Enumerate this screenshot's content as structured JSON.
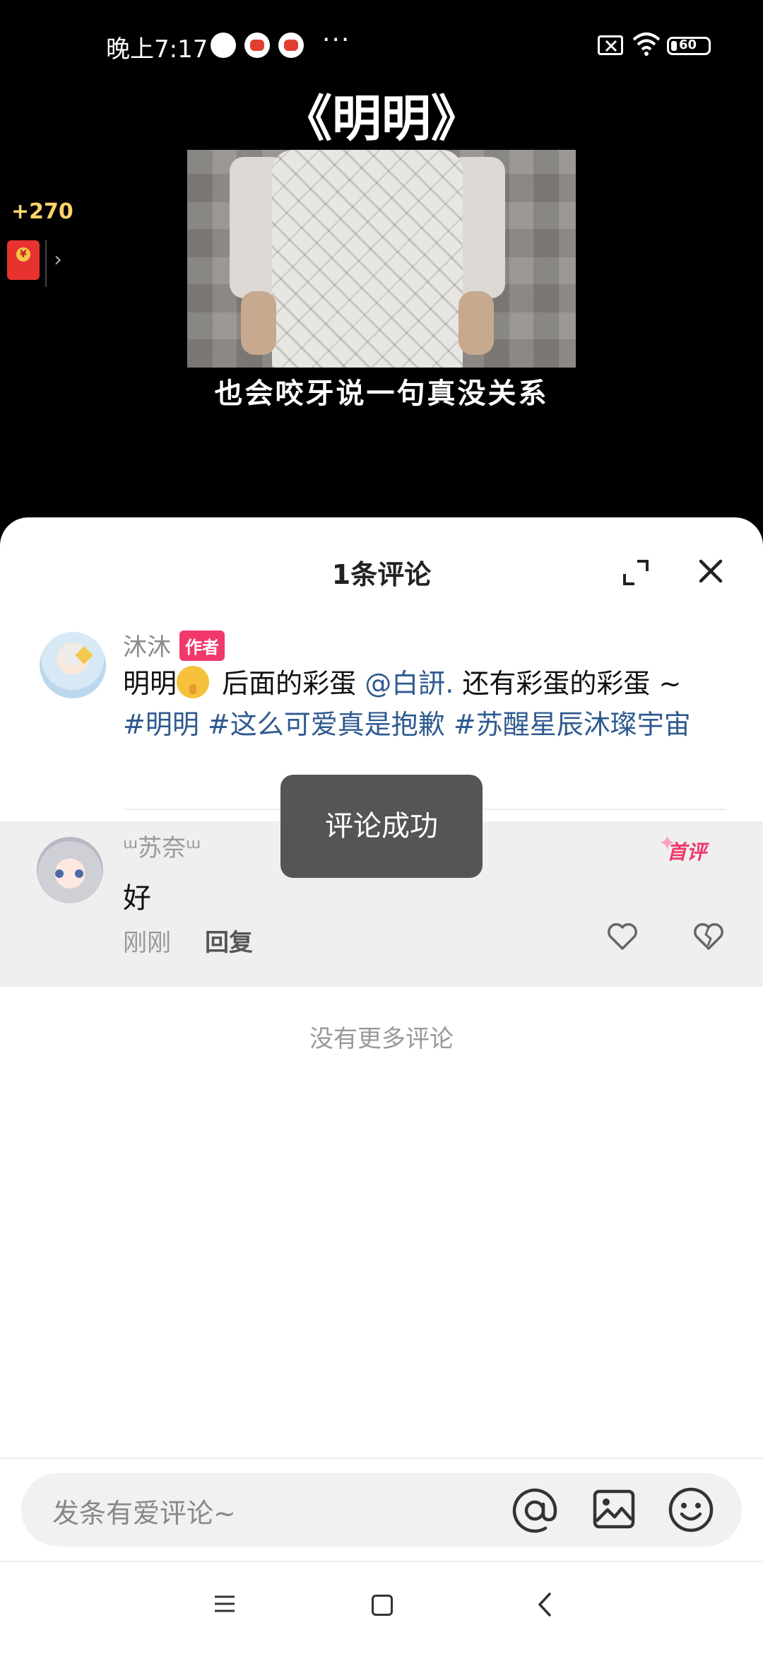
{
  "status_bar": {
    "time": "晚上7:17",
    "more": "···",
    "battery": "60"
  },
  "video": {
    "title": "《明明》",
    "caption": "也会咬牙说一句真没关系"
  },
  "reward": {
    "points": "+270",
    "arrow": "›"
  },
  "comments_sheet": {
    "header": "1条评论",
    "comments": [
      {
        "author": "沐沐",
        "tag": "作者",
        "text_part1": "明明",
        "text_part2": " 后面的彩蛋 ",
        "mention": "@白訮.",
        "text_part3": " 还有彩蛋的彩蛋 ~",
        "hashtag1": "#明明",
        "hashtag2": "#这么可爱真是抱歉",
        "hashtag3": "#苏醒星辰沐璨宇宙"
      },
      {
        "author": "ᵚ苏奈ᵚ",
        "tag": "首评",
        "text": "好",
        "time": "刚刚",
        "reply_label": "回复"
      }
    ],
    "no_more": "没有更多评论"
  },
  "toast": "评论成功",
  "input": {
    "placeholder": "发条有爱评论~"
  },
  "colors": {
    "accent_pink": "#f0386b",
    "link_blue": "#2f5a8f",
    "reward_gold": "#ffd36b"
  }
}
